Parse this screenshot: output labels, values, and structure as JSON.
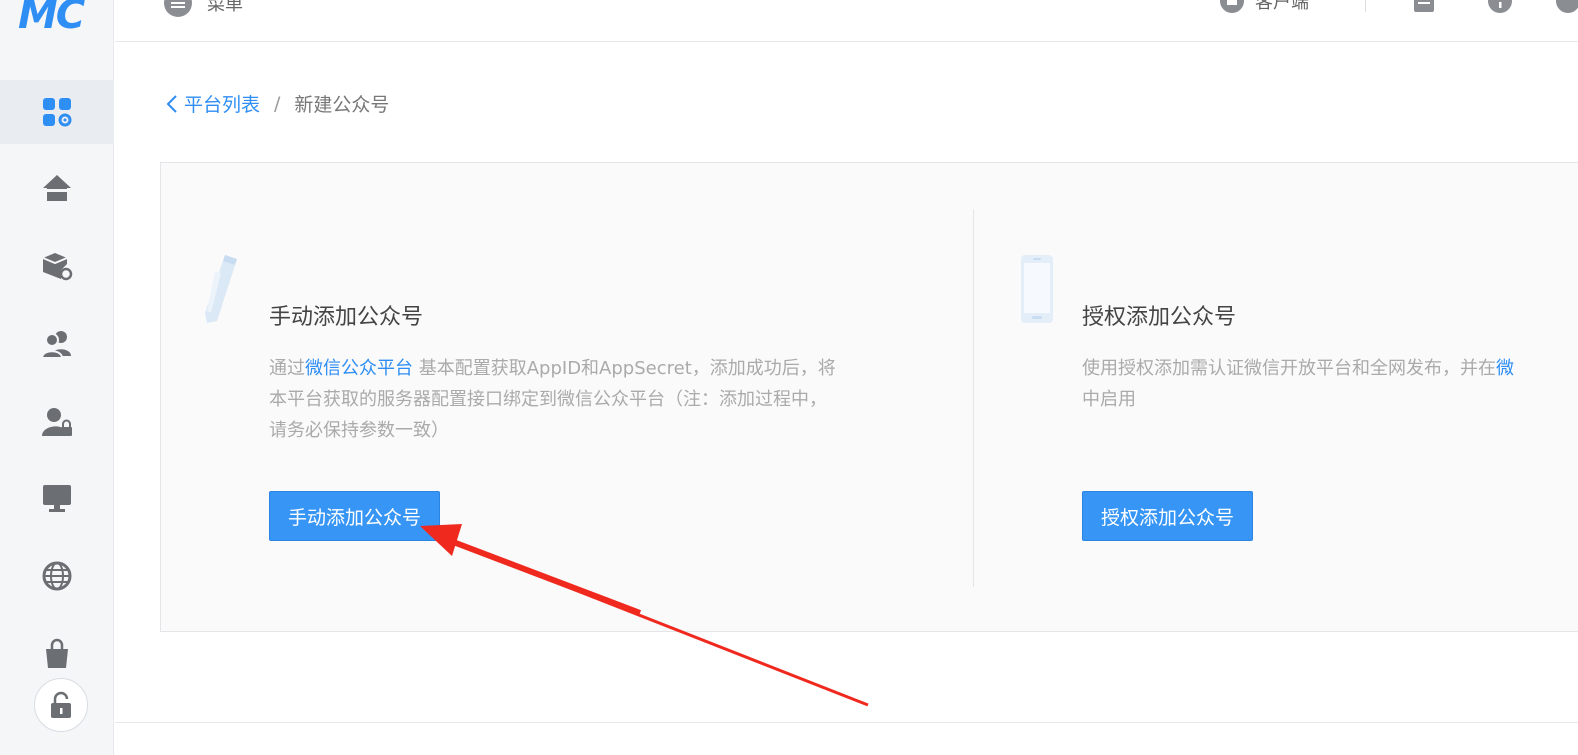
{
  "sidebar": {
    "logo": "MC",
    "items": [
      {
        "icon": "apps-gear-icon",
        "active": true
      },
      {
        "icon": "home-icon"
      },
      {
        "icon": "box-gear-icon"
      },
      {
        "icon": "users-icon"
      },
      {
        "icon": "user-lock-icon"
      },
      {
        "icon": "monitor-icon"
      },
      {
        "icon": "globe-icon"
      },
      {
        "icon": "shopping-bag-icon"
      }
    ],
    "bottom_icon": "lock-icon"
  },
  "header": {
    "menu_label": "菜单",
    "client_label": "客户端"
  },
  "breadcrumb": {
    "back_label": "平台列表",
    "separator": "/",
    "current": "新建公众号"
  },
  "manual": {
    "title": "手动添加公众号",
    "desc_prefix": "通过",
    "desc_link": "微信公众平台",
    "desc_line1_rest": " 基本配置获取AppID和AppSecret，添加成功后，将",
    "desc_line2": "本平台获取的服务器配置接口绑定到微信公众平台（注：添加过程中，",
    "desc_line3": "请务必保持参数一致）",
    "button_label": "手动添加公众号"
  },
  "auth": {
    "title": "授权添加公众号",
    "desc_line1": "使用授权添加需认证微信开放平台和全网发布，并在",
    "desc_line1_link": "微",
    "desc_line2": "中启用",
    "button_label": "授权添加公众号"
  },
  "colors": {
    "accent": "#2f8ef4",
    "button": "#3796f5",
    "annotation": "#f0291f"
  }
}
